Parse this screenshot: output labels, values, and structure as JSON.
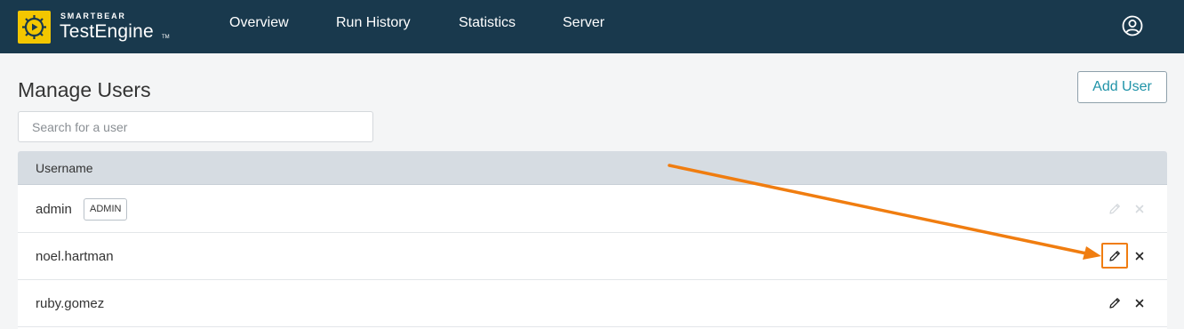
{
  "app": {
    "brand_small": "SMARTBEAR",
    "brand_name": "TestEngine",
    "brand_tm": "TM"
  },
  "nav": {
    "items": [
      {
        "label": "Overview"
      },
      {
        "label": "Run History"
      },
      {
        "label": "Statistics"
      },
      {
        "label": "Server"
      }
    ]
  },
  "page": {
    "title": "Manage Users",
    "add_user_label": "Add User",
    "search_placeholder": "Search for a user"
  },
  "table": {
    "column_header": "Username",
    "rows": [
      {
        "username": "admin",
        "badge": "ADMIN",
        "actions_enabled": false
      },
      {
        "username": "noel.hartman",
        "badge": "",
        "actions_enabled": true
      },
      {
        "username": "ruby.gomez",
        "badge": "",
        "actions_enabled": true
      }
    ]
  },
  "icons": {
    "logo": "play-gear-icon",
    "account": "user-circle-icon",
    "edit": "pencil-icon",
    "delete": "close-icon"
  },
  "colors": {
    "topbar": "#19394d",
    "logo": "#f3c700",
    "accent": "#1f93a8",
    "annotation": "#f07d10",
    "disabled_icon": "#d5d9dd"
  }
}
